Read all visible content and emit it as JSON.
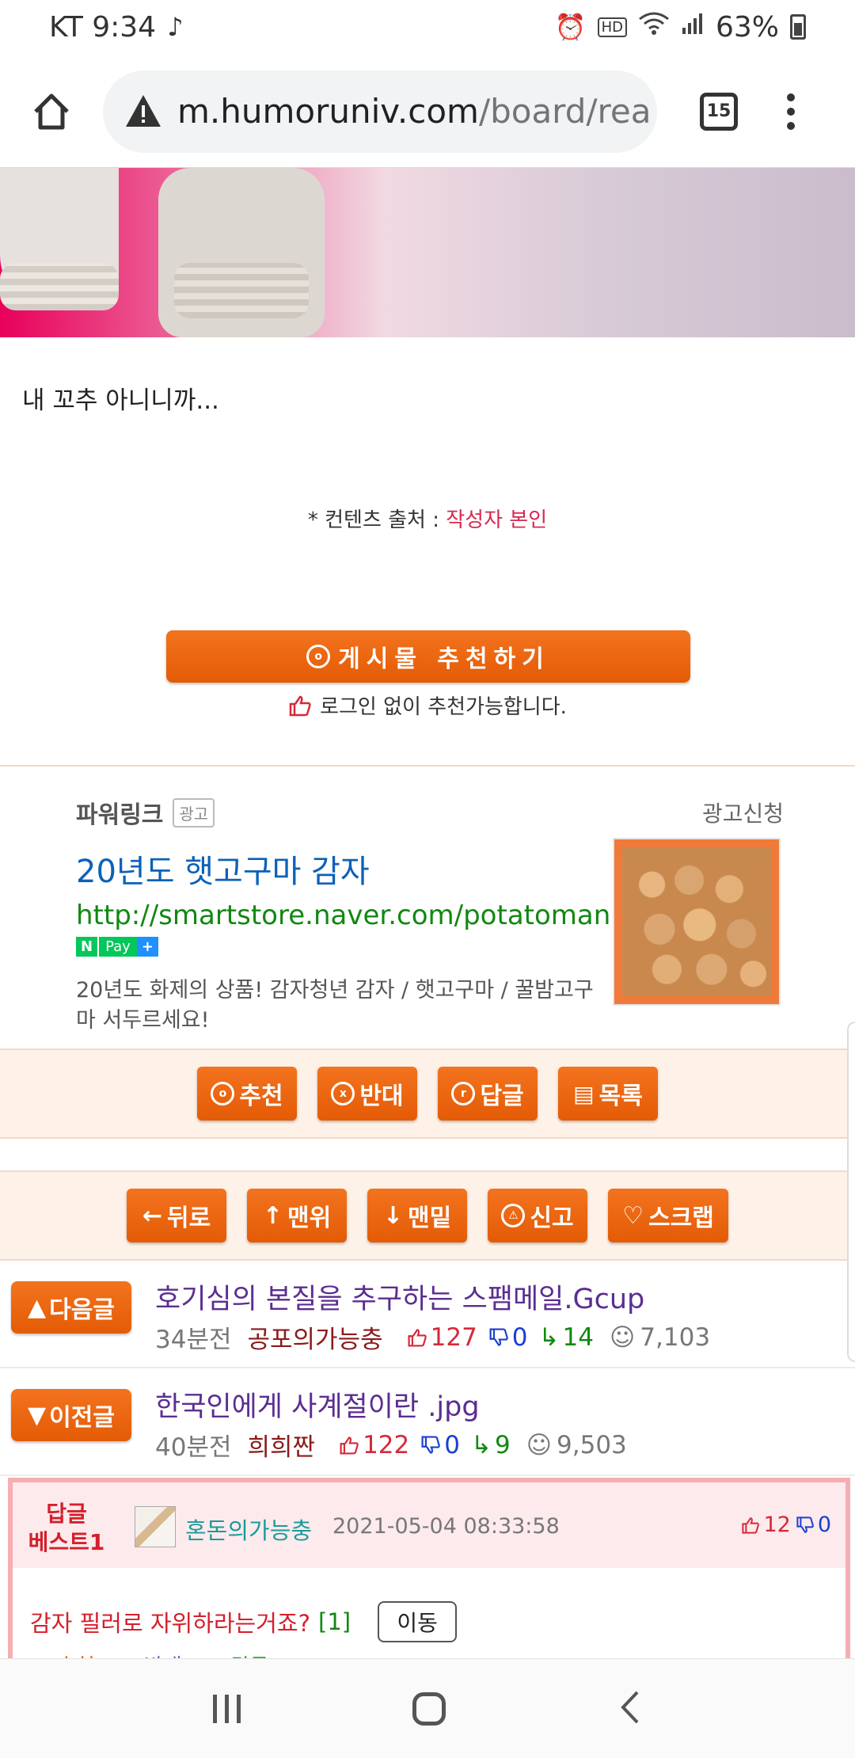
{
  "status_bar": {
    "carrier_time": "KT 9:34",
    "battery": "63%",
    "icons": [
      "tiktok-icon",
      "alarm-icon",
      "hd-icon",
      "wifi-icon",
      "signal-icon",
      "battery-icon"
    ]
  },
  "browser": {
    "url_host": "m.humoruniv.com",
    "url_path": "/board/rea",
    "tab_count": "15"
  },
  "post": {
    "body_text": "내 꼬추 아니니까...",
    "source_prefix": "* 컨텐츠 출처 :",
    "source_value": "작성자 본인",
    "recommend_button": "게시물 추천하기",
    "recommend_icon_text": "ⓞ",
    "login_note": "로그인 없이 추천가능합니다."
  },
  "ad": {
    "label": "파워링크",
    "tag": "광고",
    "apply": "광고신청",
    "title": "20년도 햇고구마 감자",
    "url": "http://smartstore.naver.com/potatoman",
    "npay_n": "N",
    "npay_text": "Pay",
    "npay_plus": "+",
    "desc": "20년도 화제의 상품! 감자청년 감자 / 햇고구마 / 꿀밤고구마 서두르세요!"
  },
  "actions": {
    "recommend": "추천",
    "oppose": "반대",
    "reply": "답글",
    "list": "목록"
  },
  "nav_actions": {
    "back": "뒤로",
    "top": "맨위",
    "bottom": "맨밑",
    "report": "신고",
    "scrap": "스크랩"
  },
  "next_post": {
    "button": "다음글",
    "title": "호기심의 본질을 추구하는 스팸메일.Gcup",
    "ago": "34분전",
    "author": "공포의가능충",
    "up": "127",
    "down": "0",
    "replies": "14",
    "views": "7,103"
  },
  "prev_post": {
    "button": "이전글",
    "title": "한국인에게 사계절이란 .jpg",
    "ago": "40분전",
    "author": "희희짠",
    "up": "122",
    "down": "0",
    "replies": "9",
    "views": "9,503"
  },
  "best_reply": {
    "label_line1": "답글",
    "label_line2": "베스트1",
    "nickname": "혼돈의가능충",
    "datetime": "2021-05-04 08:33:58",
    "up": "12",
    "down": "0",
    "comment": "감자 필러로 자위하라는거죠?",
    "count": "[1]",
    "move_button": "이동",
    "peek": [
      "추천",
      "반대",
      "답글"
    ]
  },
  "colors": {
    "accent_orange": "#e8600d",
    "link_blue": "#0b61b9",
    "up_red": "#d7283a",
    "down_blue": "#1a3fd1",
    "green": "#118811"
  }
}
